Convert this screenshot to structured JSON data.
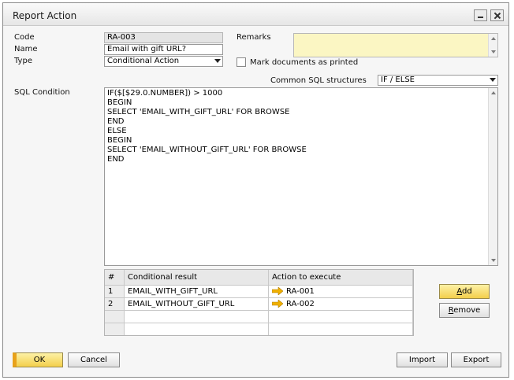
{
  "window": {
    "title": "Report Action"
  },
  "form": {
    "code_label": "Code",
    "code_value": "RA-003",
    "name_label": "Name",
    "name_value": "Email with gift URL?",
    "type_label": "Type",
    "type_value": "Conditional Action",
    "remarks_label": "Remarks",
    "remarks_value": "",
    "mark_printed_label": "Mark documents as printed",
    "common_sql_label": "Common SQL structures",
    "common_sql_value": "IF / ELSE",
    "sql_label": "SQL Condition",
    "sql_lines": [
      "IF($[$29.0.NUMBER]) > 1000",
      "BEGIN",
      "SELECT 'EMAIL_WITH_GIFT_URL' FOR BROWSE",
      "END",
      "ELSE",
      "BEGIN",
      "SELECT 'EMAIL_WITHOUT_GIFT_URL' FOR BROWSE",
      "END"
    ]
  },
  "table": {
    "headers": [
      "#",
      "Conditional result",
      "Action to execute"
    ],
    "rows": [
      {
        "num": "1",
        "result": "EMAIL_WITH_GIFT_URL",
        "action": "RA-001"
      },
      {
        "num": "2",
        "result": "EMAIL_WITHOUT_GIFT_URL",
        "action": "RA-002"
      }
    ]
  },
  "buttons": {
    "add_prefix": "",
    "add_underline": "A",
    "add_rest": "dd",
    "remove_underline": "R",
    "remove_rest": "emove",
    "ok": "OK",
    "cancel": "Cancel",
    "import": "Import",
    "export": "Export"
  },
  "colors": {
    "remarks_bg": "#fbf6c3",
    "button_yellow": "#f3cf4b",
    "link_arrow": "#f0b000"
  }
}
